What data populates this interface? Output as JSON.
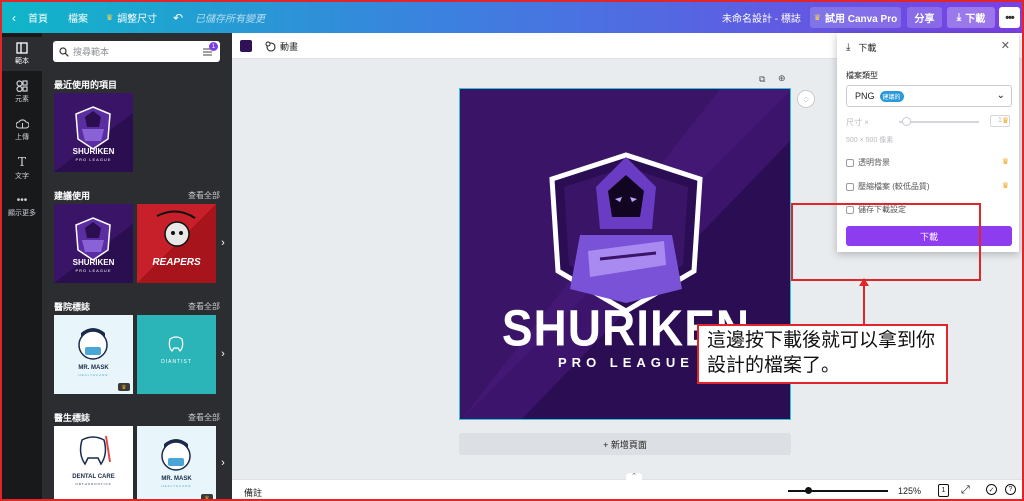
{
  "topbar": {
    "home": "首頁",
    "file": "檔案",
    "resize": "調整尺寸",
    "saved_status": "已儲存所有變更",
    "design_title": "未命名設計 - 標誌",
    "try_pro": "試用 Canva Pro",
    "share": "分享",
    "download": "下載"
  },
  "rail": {
    "items": [
      "範本",
      "元素",
      "上傳",
      "文字",
      "顯示更多"
    ]
  },
  "panel": {
    "search_placeholder": "搜尋範本",
    "filter_badge": "1",
    "recent_title": "最近使用的項目",
    "suggested_title": "建議使用",
    "clinic_title": "醫院標誌",
    "doctor_title": "醫生標誌",
    "see_all": "查看全部",
    "thumbs": {
      "shuriken_main": "SHURIKEN",
      "shuriken_sub": "PRO LEAGUE",
      "reapers": "REAPERS",
      "mr_mask": "MR. MASK",
      "mr_mask_sub": "HEALTHCARE",
      "diantist": "DIANTIST",
      "dental_care": "DENTAL CARE",
      "dental_sub": "ORTHODONTICS"
    }
  },
  "subbar": {
    "animate": "動畫",
    "color": "#2e1156"
  },
  "design": {
    "title": "SHURIKEN",
    "subtitle": "PRO LEAGUE"
  },
  "canvas": {
    "add_page": "+ 新增頁面"
  },
  "status": {
    "notes": "備註",
    "zoom": "125%",
    "page": "1"
  },
  "download_panel": {
    "title": "下載",
    "file_type_label": "檔案類型",
    "file_type": "PNG",
    "recommended": "建議的",
    "size_label": "尺寸 ×",
    "size_value": "1",
    "dimensions": "500 × 500 像素",
    "transparent_bg": "透明背景",
    "compress": "壓縮檔案 (較低品質)",
    "save_settings": "儲存下載設定",
    "download_button": "下載"
  },
  "annotation": {
    "text": "這邊按下載後就可以拿到你設計的檔案了。"
  },
  "colors": {
    "accent": "#8d3cf0",
    "annotation_red": "#e0262a"
  }
}
